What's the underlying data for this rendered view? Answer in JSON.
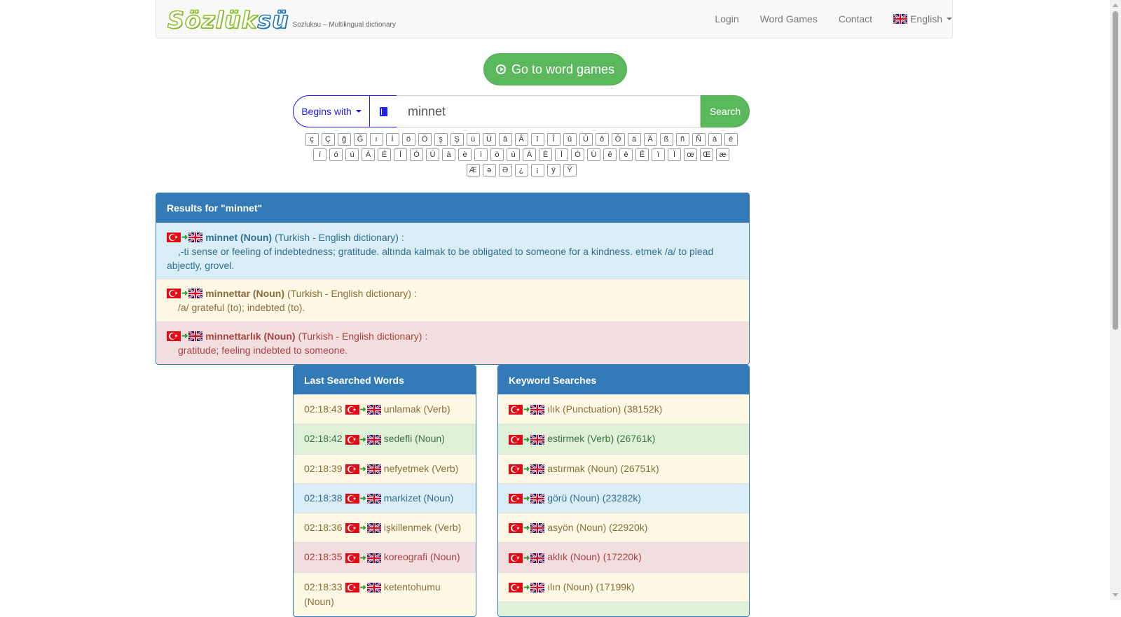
{
  "navbar": {
    "logo_part1": "Sözlük",
    "logo_part2": "sü",
    "tagline": "Sozluksu – Multilingual dictionary",
    "links": [
      "Login",
      "Word Games",
      "Contact"
    ],
    "language": "English"
  },
  "games_button": {
    "label": "Go to word games",
    "icon": "play-circle-icon"
  },
  "search": {
    "mode_label": "Begins with",
    "dict_icon": "book-icon",
    "query": "minnet",
    "button_label": "Search"
  },
  "special_chars": [
    [
      "ç",
      "Ç",
      "ğ",
      "Ğ",
      "ı",
      "İ",
      "ö",
      "Ö",
      "ş",
      "Ş",
      "ü",
      "Ü",
      "â",
      "Â",
      "î",
      "Î",
      "û",
      "Û",
      "ô",
      "Ô",
      "ä",
      "Ä",
      "ß",
      "ñ",
      "Ñ",
      "á",
      "é"
    ],
    [
      "í",
      "ó",
      "ú",
      "Á",
      "É",
      "Í",
      "Ó",
      "Ú",
      "à",
      "è",
      "ì",
      "ò",
      "ù",
      "À",
      "È",
      "Ì",
      "Ò",
      "Ù",
      "ê",
      "ë",
      "Ê",
      "ï",
      "Ï",
      "œ",
      "Œ",
      "æ"
    ],
    [
      "Æ",
      "ə",
      "Ə",
      "¿",
      "¡",
      "ÿ",
      "Ÿ"
    ]
  ],
  "results": {
    "header": "Results for \"minnet\"",
    "items": [
      {
        "word": "minnet (Noun)",
        "dict": "(Turkish - English dictionary) :",
        "definition": ",-ti sense or feeling of indebtedness; gratitude. altında kalmak to be obligated to someone for a kindness. etmek /a/ to plead abjectly, grovel.",
        "style": "info"
      },
      {
        "word": "minnettar (Noun)",
        "dict": "(Turkish - English dictionary) :",
        "definition": "/a/ grateful (to); indebted (to).",
        "style": "warning"
      },
      {
        "word": "minnettarlık (Noun)",
        "dict": "(Turkish - English dictionary) :",
        "definition": "gratitude; feeling indebted to someone.",
        "style": "danger"
      }
    ]
  },
  "last_searched": {
    "header": "Last Searched Words",
    "items": [
      {
        "time": "02:18:43",
        "word": "unlamak (Verb)",
        "style": "warning"
      },
      {
        "time": "02:18:42",
        "word": "sedefli (Noun)",
        "style": "success"
      },
      {
        "time": "02:18:39",
        "word": "nefyetmek (Verb)",
        "style": "warning"
      },
      {
        "time": "02:18:38",
        "word": "markizet (Noun)",
        "style": "info"
      },
      {
        "time": "02:18:36",
        "word": "işkillenmek (Verb)",
        "style": "warning"
      },
      {
        "time": "02:18:35",
        "word": "koreografi (Noun)",
        "style": "danger"
      },
      {
        "time": "02:18:33",
        "word": "ketentohumu (Noun)",
        "style": "warning"
      }
    ]
  },
  "keyword_searches": {
    "header": "Keyword Searches",
    "items": [
      {
        "word": "ılık (Punctuation) (38152k)",
        "style": "warning"
      },
      {
        "word": "estirmek (Verb) (26761k)",
        "style": "success"
      },
      {
        "word": "astırmak (Noun) (26751k)",
        "style": "warning"
      },
      {
        "word": "görü (Noun) (23282k)",
        "style": "info"
      },
      {
        "word": "asyön (Noun) (22920k)",
        "style": "warning"
      },
      {
        "word": "aklık (Noun) (17220k)",
        "style": "danger"
      },
      {
        "word": "ılın (Noun) (17199k)",
        "style": "warning"
      },
      {
        "word": "",
        "style": "success"
      }
    ]
  }
}
